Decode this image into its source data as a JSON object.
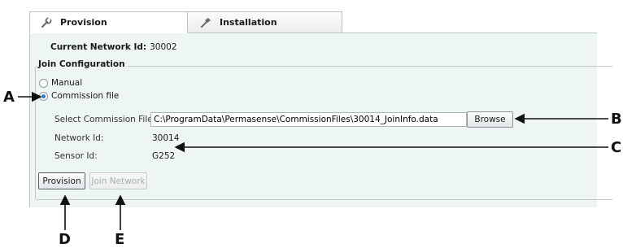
{
  "tabs": [
    {
      "label": "Provision",
      "icon": "wrench-icon",
      "active": true
    },
    {
      "label": "Installation",
      "icon": "hammer-icon",
      "active": false
    }
  ],
  "current_network": {
    "label": "Current Network Id:",
    "value": "30002"
  },
  "join_configuration": {
    "legend": "Join Configuration",
    "manual_label": "Manual",
    "commission_file_label": "Commission file",
    "selected_option": "Commission file",
    "commission_file_field_label": "Select Commission File:",
    "commission_file_path": "C:\\ProgramData\\Permasense\\CommissionFiles\\30014_JoinInfo.data",
    "browse_label": "Browse",
    "network_id_label": "Network Id:",
    "network_id_value": "30014",
    "sensor_id_label": "Sensor Id:",
    "sensor_id_value": "G252"
  },
  "actions": {
    "provision_label": "Provision",
    "join_network_label": "Join Network",
    "join_network_enabled": false
  },
  "callouts": {
    "a": "A",
    "b": "B",
    "c": "C",
    "d": "D",
    "e": "E"
  },
  "colors": {
    "panel_bg": "#eef6f4",
    "radio_accent": "#2a7dd1",
    "disabled_text": "#a7aeb2"
  }
}
